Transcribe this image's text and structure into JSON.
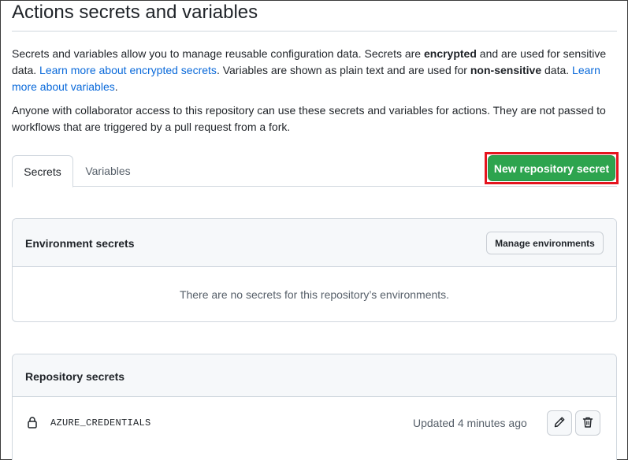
{
  "page": {
    "title": "Actions secrets and variables"
  },
  "intro": {
    "p1_part1": "Secrets and variables allow you to manage reusable configuration data. Secrets are ",
    "p1_bold1": "encrypted",
    "p1_part2": " and are used for sensitive data. ",
    "p1_link1": "Learn more about encrypted secrets",
    "p1_part3": ". Variables are shown as plain text and are used for ",
    "p1_bold2": "non-sensitive",
    "p1_part4": " data. ",
    "p1_link2": "Learn more about variables",
    "p1_part5": ".",
    "p2": "Anyone with collaborator access to this repository can use these secrets and variables for actions. They are not passed to workflows that are triggered by a pull request from a fork."
  },
  "tabs": [
    {
      "label": "Secrets",
      "active": true
    },
    {
      "label": "Variables",
      "active": false
    }
  ],
  "actions": {
    "new_secret_label": "New repository secret"
  },
  "environment_secrets": {
    "title": "Environment secrets",
    "manage_label": "Manage environments",
    "empty_message": "There are no secrets for this repository’s environments."
  },
  "repository_secrets": {
    "title": "Repository secrets",
    "items": [
      {
        "name": "AZURE_CREDENTIALS",
        "updated": "Updated 4 minutes ago",
        "icon": "lock-icon"
      }
    ]
  },
  "colors": {
    "primary_button": "#2da44e",
    "highlight_outline": "#e5141e",
    "link": "#0969da"
  }
}
